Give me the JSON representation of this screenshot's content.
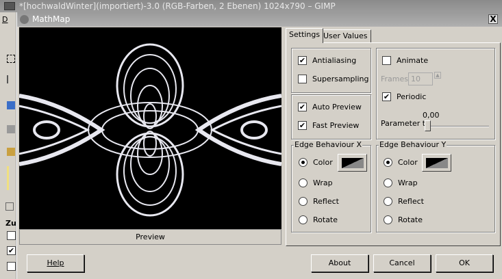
{
  "gimp_window": {
    "title": "*[hochwaldWinter](importiert)-3.0 (RGB-Farben, 2 Ebenen) 1024x790 – GIMP",
    "menu_partial": "D",
    "panel_label_partial": "Zus"
  },
  "dialog": {
    "title": "MathMap",
    "close_label": "X"
  },
  "preview": {
    "button_label": "Preview"
  },
  "tabs": [
    {
      "label": "Settings",
      "active": true
    },
    {
      "label": "User Values",
      "active": false
    }
  ],
  "settings": {
    "antialiasing": {
      "label": "Antialiasing",
      "checked": true
    },
    "supersampling": {
      "label": "Supersampling",
      "checked": false
    },
    "auto_preview": {
      "label": "Auto Preview",
      "checked": true
    },
    "fast_preview": {
      "label": "Fast Preview",
      "checked": true
    },
    "animate": {
      "label": "Animate",
      "checked": false
    },
    "frames": {
      "label": "Frames",
      "value": "10"
    },
    "periodic": {
      "label": "Periodic",
      "checked": true
    },
    "parameter_t": {
      "label": "Parameter t",
      "value": "0,00",
      "fraction": 0.0
    }
  },
  "edge_x": {
    "title": "Edge Behaviour X",
    "options": [
      "Color",
      "Wrap",
      "Reflect",
      "Rotate"
    ],
    "selected": "Color"
  },
  "edge_y": {
    "title": "Edge Behaviour Y",
    "options": [
      "Color",
      "Wrap",
      "Reflect",
      "Rotate"
    ],
    "selected": "Color"
  },
  "buttons": {
    "help": "Help",
    "about": "About",
    "cancel": "Cancel",
    "ok": "OK"
  }
}
